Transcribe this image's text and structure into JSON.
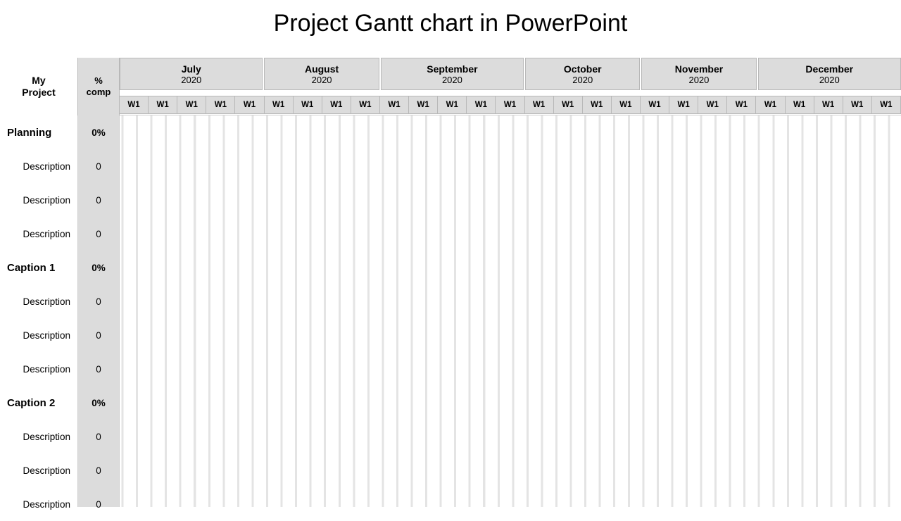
{
  "title": "Project Gantt chart in PowerPoint",
  "header": {
    "project_label": "My\nProject",
    "comp_label": "%\ncomp"
  },
  "chart_data": {
    "type": "table",
    "title": "Project Gantt chart in PowerPoint",
    "xlabel": "",
    "ylabel": "",
    "months": [
      {
        "name": "July",
        "year": "2020",
        "weeks": 5
      },
      {
        "name": "August",
        "year": "2020",
        "weeks": 4
      },
      {
        "name": "September",
        "year": "2020",
        "weeks": 5
      },
      {
        "name": "October",
        "year": "2020",
        "weeks": 4
      },
      {
        "name": "November",
        "year": "2020",
        "weeks": 4
      },
      {
        "name": "December",
        "year": "2020",
        "weeks": 5
      }
    ],
    "week_label": "W1",
    "groups": [
      {
        "name": "Planning",
        "pct": "0%",
        "tasks": [
          {
            "name": "Description",
            "pct": "0"
          },
          {
            "name": "Description",
            "pct": "0"
          },
          {
            "name": "Description",
            "pct": "0"
          }
        ]
      },
      {
        "name": "Caption 1",
        "pct": "0%",
        "tasks": [
          {
            "name": "Description",
            "pct": "0"
          },
          {
            "name": "Description",
            "pct": "0"
          },
          {
            "name": "Description",
            "pct": "0"
          }
        ]
      },
      {
        "name": "Caption 2",
        "pct": "0%",
        "tasks": [
          {
            "name": "Description",
            "pct": "0"
          },
          {
            "name": "Description",
            "pct": "0"
          },
          {
            "name": "Description",
            "pct": "0"
          }
        ]
      }
    ]
  }
}
